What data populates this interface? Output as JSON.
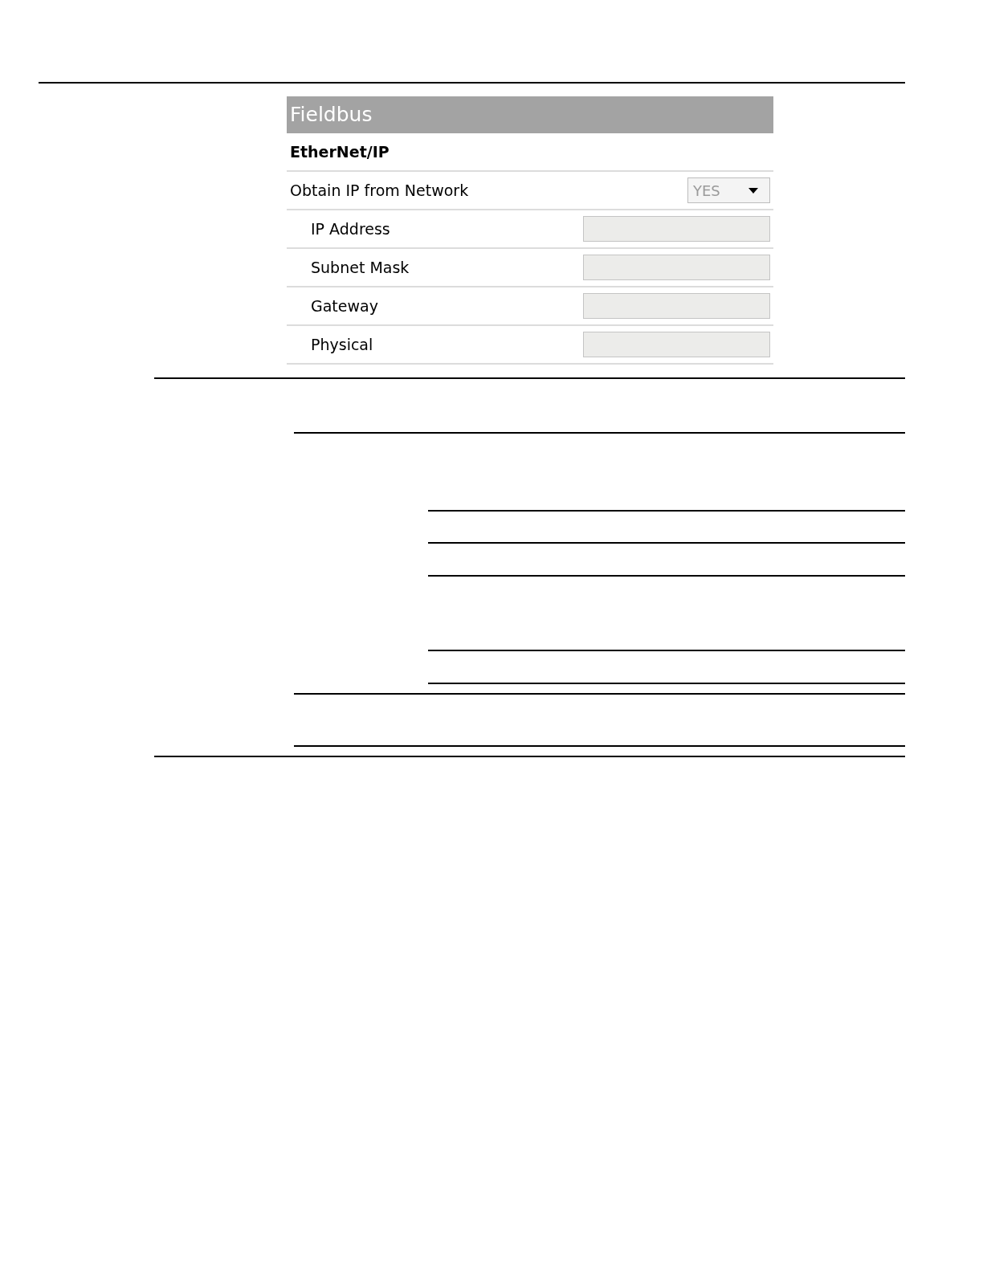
{
  "panel": {
    "title": "Fieldbus",
    "section": "EtherNet/IP",
    "rows": [
      {
        "kind": "dropdown",
        "label": "Obtain IP from Network",
        "value": "YES",
        "disabled": true
      },
      {
        "kind": "field",
        "label": "IP Address",
        "disabled": true
      },
      {
        "kind": "field",
        "label": "Subnet Mask",
        "disabled": true
      },
      {
        "kind": "field",
        "label": "Gateway",
        "disabled": true
      },
      {
        "kind": "field",
        "label": "Physical",
        "disabled": true
      }
    ]
  }
}
